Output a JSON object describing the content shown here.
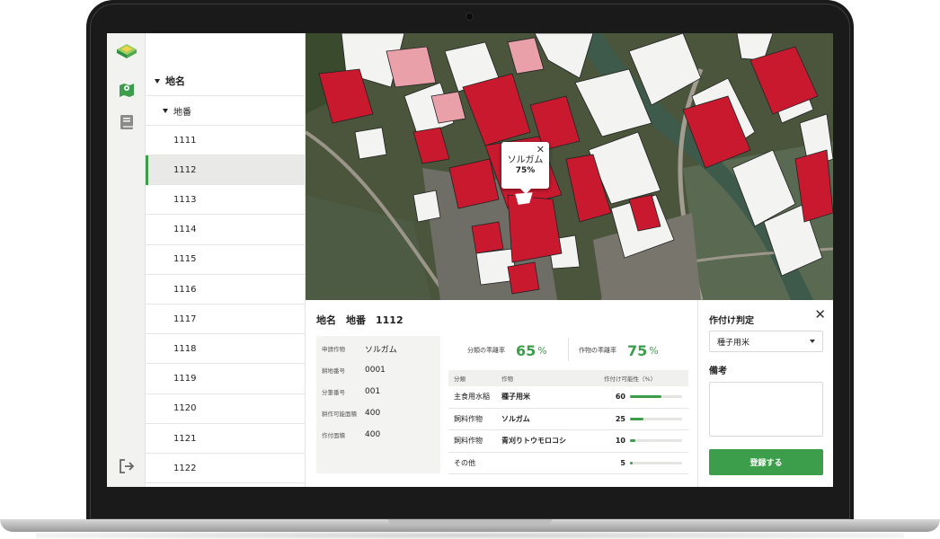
{
  "sidebar": {
    "icons": [
      {
        "name": "app-logo-icon"
      },
      {
        "name": "map-icon"
      },
      {
        "name": "book-icon"
      },
      {
        "name": "logout-icon"
      }
    ]
  },
  "tree": {
    "root_label": "地名",
    "sub_label": "地番",
    "lots": [
      "1111",
      "1112",
      "1113",
      "1114",
      "1115",
      "1116",
      "1117",
      "1118",
      "1119",
      "1120",
      "1121",
      "1122"
    ],
    "selected": "1112"
  },
  "map": {
    "popup": {
      "crop": "ソルガム",
      "percent": "75%",
      "close": "✕"
    }
  },
  "detail": {
    "title": "地名　地番　1112",
    "info": [
      {
        "key": "申請作物",
        "value": "ソルガム"
      },
      {
        "key": "耕地番号",
        "value": "0001"
      },
      {
        "key": "分筆番号",
        "value": "001"
      },
      {
        "key": "耕作可能面積",
        "value": "400"
      },
      {
        "key": "作付面積",
        "value": "400"
      }
    ],
    "rates": [
      {
        "label": "分類の乖離率",
        "value": "65",
        "unit": "%"
      },
      {
        "label": "作物の乖離率",
        "value": "75",
        "unit": "%"
      }
    ],
    "table": {
      "headers": [
        "分類",
        "作物",
        "作付け可能性（%）"
      ],
      "rows": [
        {
          "category": "主食用水稲",
          "crop": "種子用米",
          "value": 60
        },
        {
          "category": "飼料作物",
          "crop": "ソルガム",
          "value": 25
        },
        {
          "category": "飼料作物",
          "crop": "青刈りトウモロコシ",
          "value": 10
        },
        {
          "category": "その他",
          "crop": "",
          "value": 5
        }
      ]
    }
  },
  "judgment": {
    "title": "作付け判定",
    "close": "✕",
    "select_value": "種子用米",
    "memo_label": "備考",
    "memo_value": "",
    "submit_label": "登録する"
  },
  "colors": {
    "accent": "#3c9e4a",
    "field_red": "#c8192f"
  }
}
